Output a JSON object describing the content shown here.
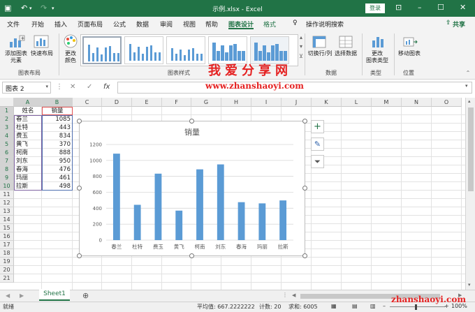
{
  "titlebar": {
    "title": "示例.xlsx  -  Excel",
    "login": "登录"
  },
  "menu": {
    "items": [
      "文件",
      "开始",
      "插入",
      "页面布局",
      "公式",
      "数据",
      "审阅",
      "视图",
      "帮助",
      "图表设计",
      "格式"
    ],
    "search": "操作说明搜索",
    "share": "共享"
  },
  "ribbon": {
    "add_element": "添加图表\n元素",
    "quick_layout": "快速布局",
    "change_color": "更改\n颜色",
    "group_layout": "图表布局",
    "group_styles": "图表样式",
    "switch_row_col": "切换行/列",
    "select_data": "选择数据",
    "group_data": "数据",
    "change_type": "更改\n图表类型",
    "group_type": "类型",
    "move_chart": "移动图表",
    "group_location": "位置"
  },
  "watermark": {
    "cn": "我爱分享网",
    "url": "www.zhanshaoyi.com",
    "url2": "zhanshaoyi.com"
  },
  "formula": {
    "namebox": "图表 2",
    "fx": "fx"
  },
  "grid": {
    "columns": [
      "A",
      "B",
      "C",
      "D",
      "E",
      "F",
      "G",
      "H",
      "I",
      "J",
      "K",
      "L",
      "M",
      "N",
      "O"
    ],
    "rows": [
      "1",
      "2",
      "3",
      "4",
      "5",
      "6",
      "7",
      "8",
      "9",
      "10",
      "11",
      "12",
      "13",
      "14",
      "15",
      "16",
      "17",
      "18",
      "19",
      "20",
      "21"
    ],
    "header_name": "姓名",
    "header_value": "销量",
    "data": [
      {
        "name": "春兰",
        "value": "1085"
      },
      {
        "name": "杜特",
        "value": "443"
      },
      {
        "name": "费玉",
        "value": "834"
      },
      {
        "name": "黄飞",
        "value": "370"
      },
      {
        "name": "柯南",
        "value": "888"
      },
      {
        "name": "刘东",
        "value": "950"
      },
      {
        "name": "春海",
        "value": "476"
      },
      {
        "name": "玛丽",
        "value": "461"
      },
      {
        "name": "拉斯",
        "value": "498"
      }
    ]
  },
  "chart_data": {
    "type": "bar",
    "title": "销量",
    "categories": [
      "春兰",
      "杜特",
      "费玉",
      "黄飞",
      "柯南",
      "刘东",
      "春海",
      "玛丽",
      "拉斯"
    ],
    "values": [
      1085,
      443,
      834,
      370,
      888,
      950,
      476,
      461,
      498
    ],
    "yticks": [
      "0",
      "200",
      "400",
      "600",
      "800",
      "1000",
      "1200"
    ],
    "ylim": [
      0,
      1200
    ],
    "bar_color": "#5b9bd5",
    "grid": true
  },
  "sheets": {
    "tab": "Sheet1"
  },
  "status": {
    "ready": "就绪",
    "avg": "平均值: 667.2222222",
    "count": "计数: 20",
    "sum": "求和: 6005",
    "zoom": "100%"
  },
  "colors": {
    "accent": "#217346"
  }
}
